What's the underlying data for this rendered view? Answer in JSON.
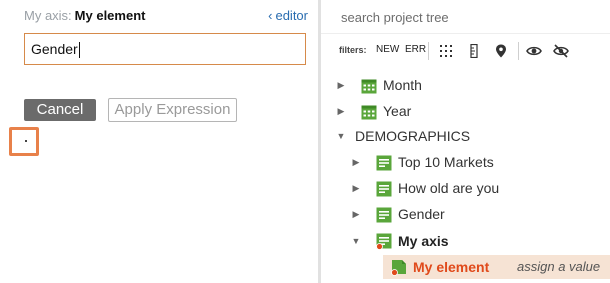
{
  "editor": {
    "axis_label": "My axis:",
    "element_name": "My element",
    "editor_link": "editor",
    "expression_value": "Gender",
    "cancel_label": "Cancel",
    "apply_label": "Apply Expression",
    "highlight_text": "."
  },
  "tree": {
    "search_placeholder": "search project tree",
    "filters_label": "filters:",
    "filter_new": "NEW",
    "filter_err": "ERR",
    "items": [
      {
        "label": "Month",
        "icon": "calendar-icon"
      },
      {
        "label": "Year",
        "icon": "calendar-icon"
      },
      {
        "label": "DEMOGRAPHICS",
        "icon": "none"
      },
      {
        "label": "Top 10 Markets",
        "icon": "variable-icon"
      },
      {
        "label": "How old are you",
        "icon": "variable-icon"
      },
      {
        "label": "Gender",
        "icon": "variable-icon"
      },
      {
        "label": "My axis",
        "icon": "variable-error-icon"
      },
      {
        "label": "My element",
        "icon": "element-error-icon",
        "hint": "assign a value"
      }
    ]
  },
  "colors": {
    "accent_orange": "#e04a1b",
    "icon_green": "#5aa63b",
    "selected_row": "#f6e3d4",
    "link_blue": "#2a6db0"
  }
}
